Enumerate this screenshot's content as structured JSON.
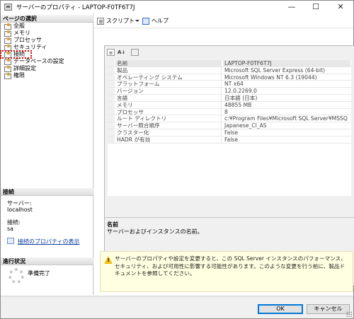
{
  "window": {
    "title": "サーバーのプロパティ - LAPTOP-F0TF6T7J",
    "controls": [
      "—",
      "☐",
      "✕"
    ]
  },
  "left_pane": {
    "page_select_header": "ページの選択",
    "pages": [
      {
        "label": "全般",
        "selected": false
      },
      {
        "label": "メモリ",
        "selected": false
      },
      {
        "label": "プロセッサ",
        "selected": false
      },
      {
        "label": "セキュリティ",
        "selected": false
      },
      {
        "label": "接続",
        "selected": false
      },
      {
        "label": "データベースの設定",
        "selected": false
      },
      {
        "label": "詳細設定",
        "selected": false
      },
      {
        "label": "権限",
        "selected": false
      }
    ],
    "connection": {
      "header": "接続",
      "server_label": "サーバー:",
      "server_value": "localhost",
      "connection_label": "接続:",
      "connection_value": "sa",
      "view_properties_link": "接続のプロパティの表示"
    },
    "progress": {
      "header": "進行状況",
      "status": "準備完了"
    }
  },
  "toolbar": {
    "script_label": "スクリプト",
    "help_label": "ヘルプ"
  },
  "property_grid": {
    "rows": [
      {
        "name": "名前",
        "value": "LAPTOP-F0TF6T7J"
      },
      {
        "name": "製品",
        "value": "Microsoft SQL Server Express (64-bit)"
      },
      {
        "name": "オペレーティング システム",
        "value": "Microsoft Windows NT 6.3 (19044)"
      },
      {
        "name": "プラットフォーム",
        "value": "NT x64"
      },
      {
        "name": "バージョン",
        "value": "12.0.2269.0"
      },
      {
        "name": "言語",
        "value": "日本語 (日本)"
      },
      {
        "name": "メモリ",
        "value": "48855 MB"
      },
      {
        "name": "プロセッサ",
        "value": "8"
      },
      {
        "name": "ルート ディレクトリ",
        "value": "c:¥Program Files¥Microsoft SQL Server¥MSSQ"
      },
      {
        "name": "サーバー照合順序",
        "value": "Japanese_CI_AS"
      },
      {
        "name": "クラスター化",
        "value": "False"
      },
      {
        "name": "HADR が有効",
        "value": "False"
      }
    ],
    "description": {
      "title": "名前",
      "text": "サーバーおよびインスタンスの名前。"
    }
  },
  "warning": {
    "text": "サーバーのプロパティや設定を変更すると、この SQL Server インスタンスのパフォーマンス、セキュリティ、および可用性に影響する可能性があります。このような変更を行う前に、製品ドキュメントを参照してください。"
  },
  "footer": {
    "ok_label": "OK",
    "cancel_label": "キャンセル"
  },
  "colors": {
    "warning_background": "#ffffe1",
    "link": "#0a3b9c",
    "highlight_box": "#cc0000"
  }
}
